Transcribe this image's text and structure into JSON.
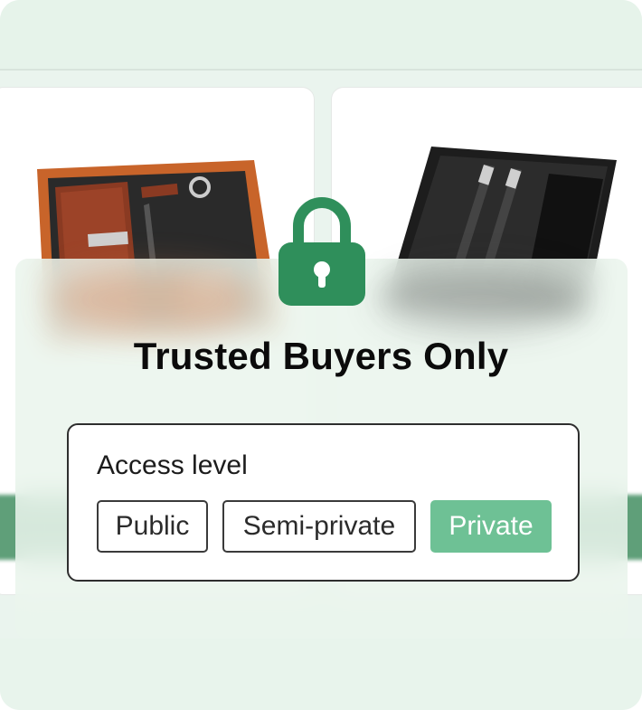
{
  "overlay": {
    "title": "Trusted Buyers Only",
    "icon": "lock-icon"
  },
  "access": {
    "label": "Access level",
    "options": [
      "Public",
      "Semi-private",
      "Private"
    ],
    "selected": "Private"
  },
  "colors": {
    "accent": "#6ec195",
    "lock": "#2f8f5b",
    "strip": "#5f9f79"
  }
}
